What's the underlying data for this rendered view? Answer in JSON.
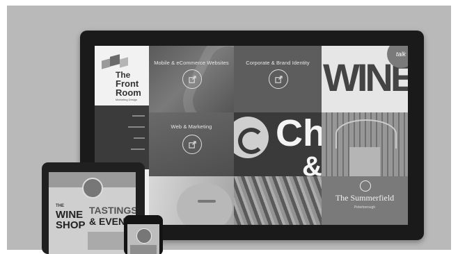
{
  "tiles": {
    "websites_label": "Mobile & eCommerce Websites",
    "identity_label": "Corporate & Brand Identity",
    "marketing_label": "Web & Marketing"
  },
  "frontroom": {
    "line1": "The",
    "line2": "Front",
    "line3": "Room",
    "tagline": "Marketing Design"
  },
  "sidebar": {
    "items": [
      "",
      "",
      "",
      ""
    ]
  },
  "brand_letters": {
    "big": "Ch",
    "amp": "&"
  },
  "wine_top": "WINE",
  "talk_badge": "talk",
  "summerfield": {
    "title": "The Summerfield",
    "sub": "Peterborough"
  },
  "tablet": {
    "the": "THE",
    "wine": "WINE",
    "shop": "SHOP",
    "tastings": "TASTINGS",
    "events": "& EVENTS"
  },
  "colors": {
    "monitor_bezel": "#1a1a1a",
    "tile_dark": "#4a4a4a",
    "tile_mid": "#6e6e6e",
    "caption": "#e8e8e8"
  }
}
